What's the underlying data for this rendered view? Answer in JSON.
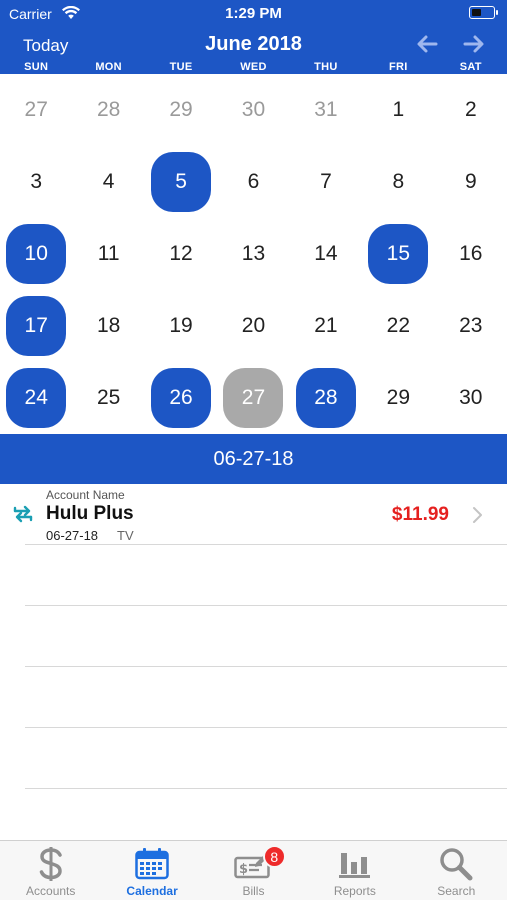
{
  "status_bar": {
    "carrier": "Carrier",
    "time": "1:29 PM"
  },
  "nav": {
    "today_label": "Today",
    "month_title": "June 2018"
  },
  "weekdays": [
    "SUN",
    "MON",
    "TUE",
    "WED",
    "THU",
    "FRI",
    "SAT"
  ],
  "calendar": {
    "days": [
      {
        "d": "27",
        "state": "muted"
      },
      {
        "d": "28",
        "state": "muted"
      },
      {
        "d": "29",
        "state": "muted"
      },
      {
        "d": "30",
        "state": "muted"
      },
      {
        "d": "31",
        "state": "muted"
      },
      {
        "d": "1",
        "state": "normal"
      },
      {
        "d": "2",
        "state": "normal"
      },
      {
        "d": "3",
        "state": "normal"
      },
      {
        "d": "4",
        "state": "normal"
      },
      {
        "d": "5",
        "state": "marked"
      },
      {
        "d": "6",
        "state": "normal"
      },
      {
        "d": "7",
        "state": "normal"
      },
      {
        "d": "8",
        "state": "normal"
      },
      {
        "d": "9",
        "state": "normal"
      },
      {
        "d": "10",
        "state": "marked"
      },
      {
        "d": "11",
        "state": "normal"
      },
      {
        "d": "12",
        "state": "normal"
      },
      {
        "d": "13",
        "state": "normal"
      },
      {
        "d": "14",
        "state": "normal"
      },
      {
        "d": "15",
        "state": "marked"
      },
      {
        "d": "16",
        "state": "normal"
      },
      {
        "d": "17",
        "state": "marked"
      },
      {
        "d": "18",
        "state": "normal"
      },
      {
        "d": "19",
        "state": "normal"
      },
      {
        "d": "20",
        "state": "normal"
      },
      {
        "d": "21",
        "state": "normal"
      },
      {
        "d": "22",
        "state": "normal"
      },
      {
        "d": "23",
        "state": "normal"
      },
      {
        "d": "24",
        "state": "marked"
      },
      {
        "d": "25",
        "state": "normal"
      },
      {
        "d": "26",
        "state": "marked"
      },
      {
        "d": "27",
        "state": "selected"
      },
      {
        "d": "28",
        "state": "marked"
      },
      {
        "d": "29",
        "state": "normal"
      },
      {
        "d": "30",
        "state": "normal"
      }
    ]
  },
  "selected_date": "06-27-18",
  "transaction": {
    "account_label": "Account Name",
    "account_name": "Hulu Plus",
    "date": "06-27-18",
    "category": "TV",
    "amount": "$11.99",
    "icon": "repeat-icon"
  },
  "tabs": [
    {
      "label": "Accounts",
      "icon": "dollar-icon",
      "active": false
    },
    {
      "label": "Calendar",
      "icon": "calendar-icon",
      "active": true
    },
    {
      "label": "Bills",
      "icon": "bills-icon",
      "active": false,
      "badge": "8"
    },
    {
      "label": "Reports",
      "icon": "reports-icon",
      "active": false
    },
    {
      "label": "Search",
      "icon": "search-icon",
      "active": false
    }
  ],
  "colors": {
    "accent": "#1d56c5",
    "amount": "#e5201f",
    "selected_day": "#a9a9a9",
    "badge": "#ee2b2b"
  }
}
